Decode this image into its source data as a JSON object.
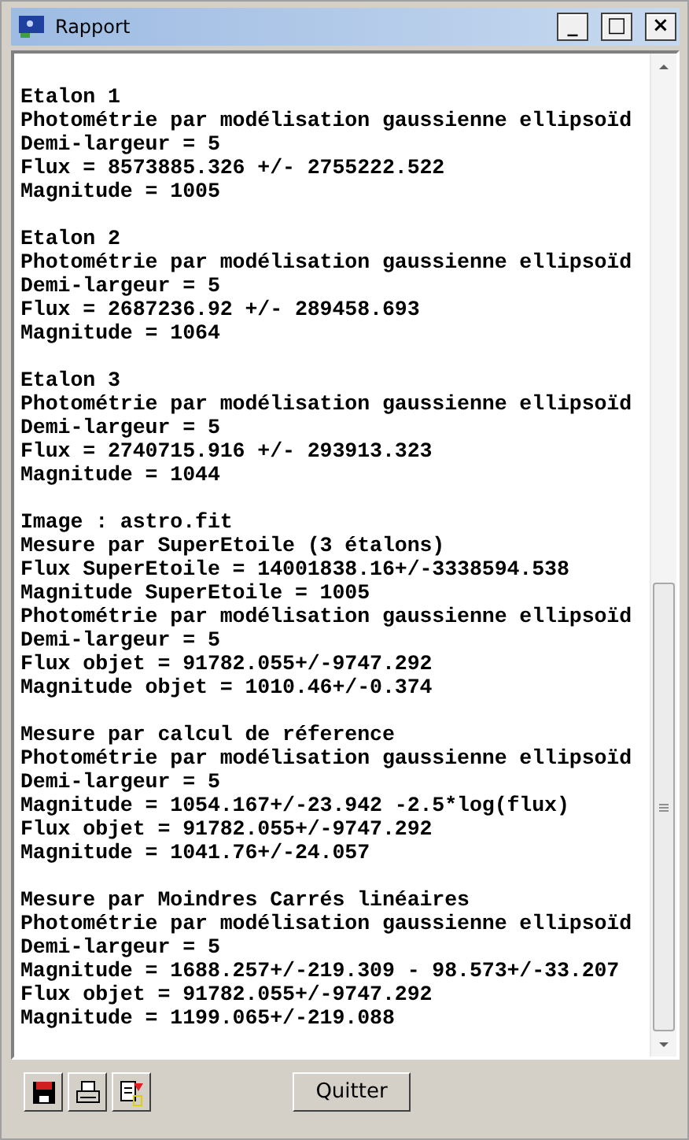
{
  "window": {
    "title": "Rapport",
    "controls": [
      "_",
      "□",
      "×"
    ]
  },
  "report": [
    {
      "lines": [
        "Etalon 1",
        "Photométrie par modélisation gaussienne ellipsoïd",
        "Demi-largeur = 5",
        "Flux = 8573885.326 +/- 2755222.522",
        "Magnitude = 1005"
      ]
    },
    {
      "lines": [
        "Etalon 2",
        "Photométrie par modélisation gaussienne ellipsoïd",
        "Demi-largeur = 5",
        "Flux = 2687236.92 +/- 289458.693",
        "Magnitude = 1064"
      ]
    },
    {
      "lines": [
        "Etalon 3",
        "Photométrie par modélisation gaussienne ellipsoïd",
        "Demi-largeur = 5",
        "Flux = 2740715.916 +/- 293913.323",
        "Magnitude = 1044"
      ]
    },
    {
      "lines": [
        "Image : astro.fit",
        "Mesure par SuperEtoile (3 étalons)",
        "Flux SuperEtoile = 14001838.16+/-3338594.538",
        "Magnitude SuperEtoile = 1005",
        "Photométrie par modélisation gaussienne ellipsoïd",
        "Demi-largeur = 5",
        "Flux objet = 91782.055+/-9747.292",
        "Magnitude objet = 1010.46+/-0.374"
      ]
    },
    {
      "lines": [
        "Mesure par calcul de réference",
        "Photométrie par modélisation gaussienne ellipsoïd",
        "Demi-largeur = 5",
        "Magnitude = 1054.167+/-23.942 -2.5*log(flux)",
        "Flux objet = 91782.055+/-9747.292",
        "Magnitude = 1041.76+/-24.057"
      ]
    },
    {
      "lines": [
        "Mesure par Moindres Carrés linéaires",
        "Photométrie par modélisation gaussienne ellipsoïd",
        "Demi-largeur = 5",
        "Magnitude = 1688.257+/-219.309 - 98.573+/-33.207",
        "Flux objet = 91782.055+/-9747.292",
        "Magnitude = 1199.065+/-219.088"
      ]
    }
  ],
  "toolbar": [
    {
      "kind": "save"
    },
    {
      "kind": "print"
    },
    {
      "kind": "export"
    }
  ],
  "quit_button": {
    "label": "Quitter"
  }
}
